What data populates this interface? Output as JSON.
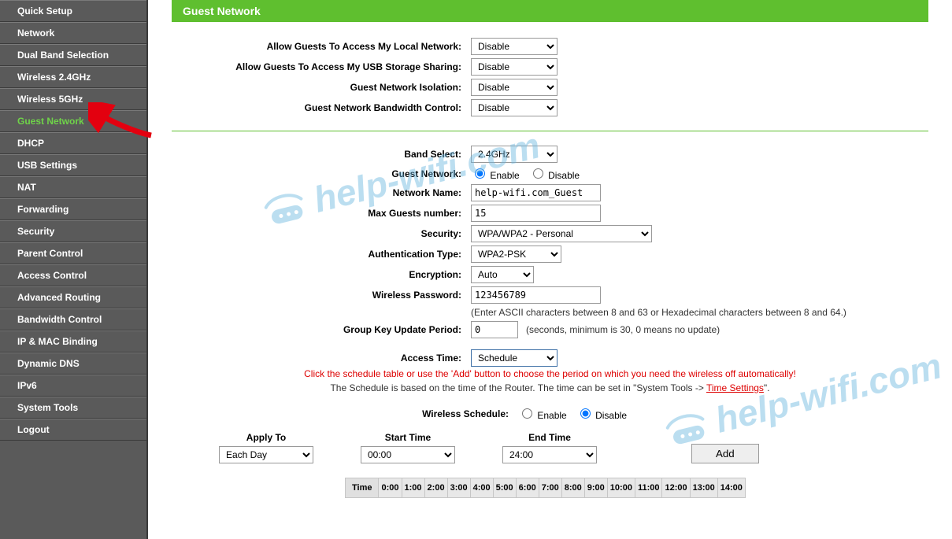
{
  "sidebar": {
    "items": [
      {
        "label": "Quick Setup"
      },
      {
        "label": "Network"
      },
      {
        "label": "Dual Band Selection"
      },
      {
        "label": "Wireless 2.4GHz"
      },
      {
        "label": "Wireless 5GHz"
      },
      {
        "label": "Guest Network",
        "active": true
      },
      {
        "label": "DHCP"
      },
      {
        "label": "USB Settings"
      },
      {
        "label": "NAT"
      },
      {
        "label": "Forwarding"
      },
      {
        "label": "Security"
      },
      {
        "label": "Parent Control"
      },
      {
        "label": "Access Control"
      },
      {
        "label": "Advanced Routing"
      },
      {
        "label": "Bandwidth Control"
      },
      {
        "label": "IP & MAC Binding"
      },
      {
        "label": "Dynamic DNS"
      },
      {
        "label": "IPv6"
      },
      {
        "label": "System Tools"
      },
      {
        "label": "Logout"
      }
    ]
  },
  "page": {
    "title": "Guest Network"
  },
  "top_group": {
    "allow_local": {
      "label": "Allow Guests To Access My Local Network:",
      "value": "Disable"
    },
    "allow_usb": {
      "label": "Allow Guests To Access My USB Storage Sharing:",
      "value": "Disable"
    },
    "isolation": {
      "label": "Guest Network Isolation:",
      "value": "Disable"
    },
    "bw_control": {
      "label": "Guest Network Bandwidth Control:",
      "value": "Disable"
    }
  },
  "mid_group": {
    "band_select": {
      "label": "Band Select:",
      "value": "2.4GHz"
    },
    "guest_network": {
      "label": "Guest Network:",
      "enable": "Enable",
      "disable": "Disable",
      "selected": "enable"
    },
    "network_name": {
      "label": "Network Name:",
      "value": "help-wifi.com_Guest"
    },
    "max_guests": {
      "label": "Max Guests number:",
      "value": "15"
    },
    "security": {
      "label": "Security:",
      "value": "WPA/WPA2 - Personal"
    },
    "auth_type": {
      "label": "Authentication Type:",
      "value": "WPA2-PSK"
    },
    "encryption": {
      "label": "Encryption:",
      "value": "Auto"
    },
    "password": {
      "label": "Wireless Password:",
      "value": "123456789",
      "hint": "(Enter ASCII characters between 8 and 63 or Hexadecimal characters between 8 and 64.)"
    },
    "gk_period": {
      "label": "Group Key Update Period:",
      "value": "0",
      "hint": "(seconds, minimum is 30, 0 means no update)"
    },
    "access_time": {
      "label": "Access Time:",
      "value": "Schedule"
    },
    "red_note": "Click the schedule table or use the 'Add' button to choose the period on which you need the wireless off automatically!",
    "sched_note_pre": "The Schedule is based on the time of the Router. The time can be set in \"System Tools -> ",
    "sched_note_link": "Time Settings",
    "sched_note_post": "\".",
    "wireless_schedule": {
      "label": "Wireless Schedule:",
      "enable": "Enable",
      "disable": "Disable",
      "selected": "disable"
    }
  },
  "schedule": {
    "apply_to": {
      "label": "Apply To",
      "value": "Each Day"
    },
    "start_time": {
      "label": "Start Time",
      "value": "00:00"
    },
    "end_time": {
      "label": "End Time",
      "value": "24:00"
    },
    "add": "Add",
    "time_header": "Time",
    "hours": [
      "0:00",
      "1:00",
      "2:00",
      "3:00",
      "4:00",
      "5:00",
      "6:00",
      "7:00",
      "8:00",
      "9:00",
      "10:00",
      "11:00",
      "12:00",
      "13:00",
      "14:00"
    ]
  },
  "watermark": "help-wifi.com"
}
